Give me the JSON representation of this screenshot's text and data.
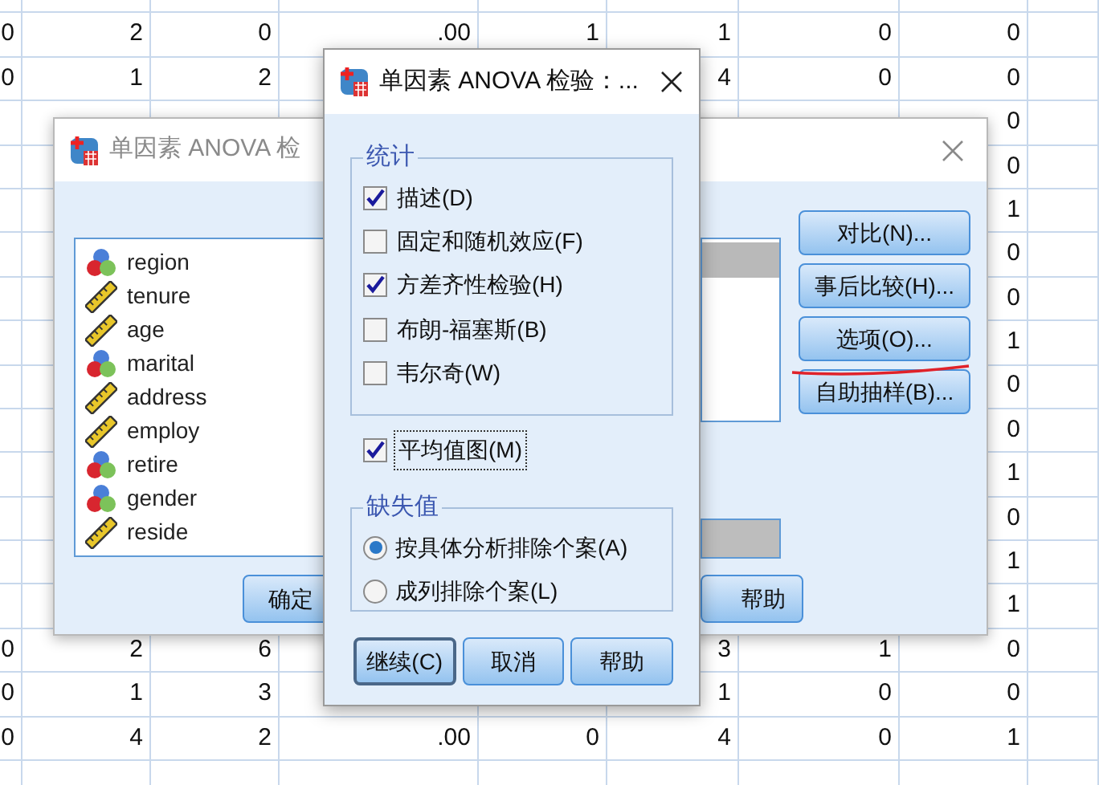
{
  "data_grid": {
    "rows": [
      [
        null,
        null,
        null,
        null,
        null,
        null,
        null,
        null
      ],
      [
        "0",
        "2",
        "0",
        ".00",
        "1",
        "1",
        "0",
        "0"
      ],
      [
        "0",
        "1",
        "2",
        null,
        null,
        "4",
        "0",
        "0"
      ],
      [
        null,
        null,
        null,
        null,
        null,
        null,
        null,
        "0"
      ],
      [
        null,
        null,
        null,
        null,
        null,
        null,
        null,
        "0"
      ],
      [
        null,
        null,
        null,
        null,
        null,
        null,
        null,
        "1"
      ],
      [
        null,
        null,
        null,
        null,
        null,
        null,
        null,
        "0"
      ],
      [
        null,
        null,
        null,
        null,
        null,
        null,
        null,
        "0"
      ],
      [
        null,
        null,
        null,
        null,
        null,
        null,
        null,
        "1"
      ],
      [
        null,
        null,
        null,
        null,
        null,
        null,
        null,
        "0"
      ],
      [
        null,
        null,
        null,
        null,
        null,
        null,
        null,
        "0"
      ],
      [
        null,
        null,
        null,
        null,
        null,
        null,
        null,
        "1"
      ],
      [
        null,
        null,
        null,
        null,
        null,
        null,
        null,
        "0"
      ],
      [
        null,
        null,
        null,
        null,
        null,
        null,
        null,
        "1"
      ],
      [
        null,
        null,
        null,
        null,
        null,
        null,
        null,
        "1"
      ],
      [
        "0",
        "2",
        "6",
        null,
        null,
        "3",
        "1",
        "0"
      ],
      [
        "0",
        "1",
        "3",
        null,
        null,
        "1",
        "0",
        "0"
      ],
      [
        "0",
        "4",
        "2",
        ".00",
        "0",
        "4",
        "0",
        "1"
      ]
    ]
  },
  "back_dialog": {
    "title": "单因素 ANOVA 检",
    "variables": [
      {
        "name": "region",
        "kind": "nominal"
      },
      {
        "name": "tenure",
        "kind": "scale"
      },
      {
        "name": "age",
        "kind": "scale"
      },
      {
        "name": "marital",
        "kind": "nominal"
      },
      {
        "name": "address",
        "kind": "scale"
      },
      {
        "name": "employ",
        "kind": "scale"
      },
      {
        "name": "retire",
        "kind": "nominal"
      },
      {
        "name": "gender",
        "kind": "nominal"
      },
      {
        "name": "reside",
        "kind": "scale"
      }
    ],
    "side_buttons": [
      "对比(N)...",
      "事后比较(H)...",
      "选项(O)...",
      "自助抽样(B)..."
    ],
    "bottom_buttons": [
      "确定",
      "帮助"
    ]
  },
  "front_dialog": {
    "title": "单因素 ANOVA 检验：...",
    "statistics": {
      "title": "统计",
      "options": [
        {
          "label": "描述(D)",
          "checked": true
        },
        {
          "label": "固定和随机效应(F)",
          "checked": false
        },
        {
          "label": "方差齐性检验(H)",
          "checked": true
        },
        {
          "label": "布朗-福塞斯(B)",
          "checked": false
        },
        {
          "label": "韦尔奇(W)",
          "checked": false
        }
      ]
    },
    "means_plot": {
      "label": "平均值图(M)",
      "checked": true,
      "focused": true
    },
    "missing_values": {
      "title": "缺失值",
      "options": [
        {
          "label": "按具体分析排除个案(A)",
          "selected": true
        },
        {
          "label": "成列排除个案(L)",
          "selected": false
        }
      ]
    },
    "buttons": [
      {
        "label": "继续(C)",
        "default": true
      },
      {
        "label": "取消",
        "default": false
      },
      {
        "label": "帮助",
        "default": false
      }
    ]
  }
}
